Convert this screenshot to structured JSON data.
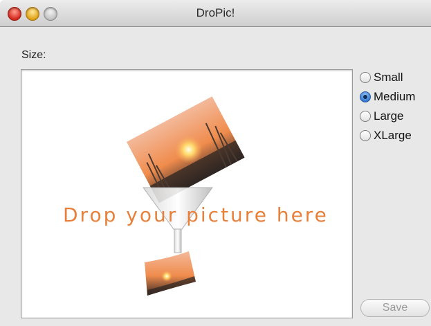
{
  "window": {
    "title": "DroPic!"
  },
  "size_label": "Size:",
  "drop_area": {
    "prompt": "Drop your picture here"
  },
  "size_options": [
    {
      "label": "Small",
      "selected": false
    },
    {
      "label": "Medium",
      "selected": true
    },
    {
      "label": "Large",
      "selected": false
    },
    {
      "label": "XLarge",
      "selected": false
    }
  ],
  "save_button": {
    "label": "Save",
    "enabled": false
  },
  "colors": {
    "prompt_text": "#e8803a",
    "radio_selected": "#2f74d0"
  }
}
